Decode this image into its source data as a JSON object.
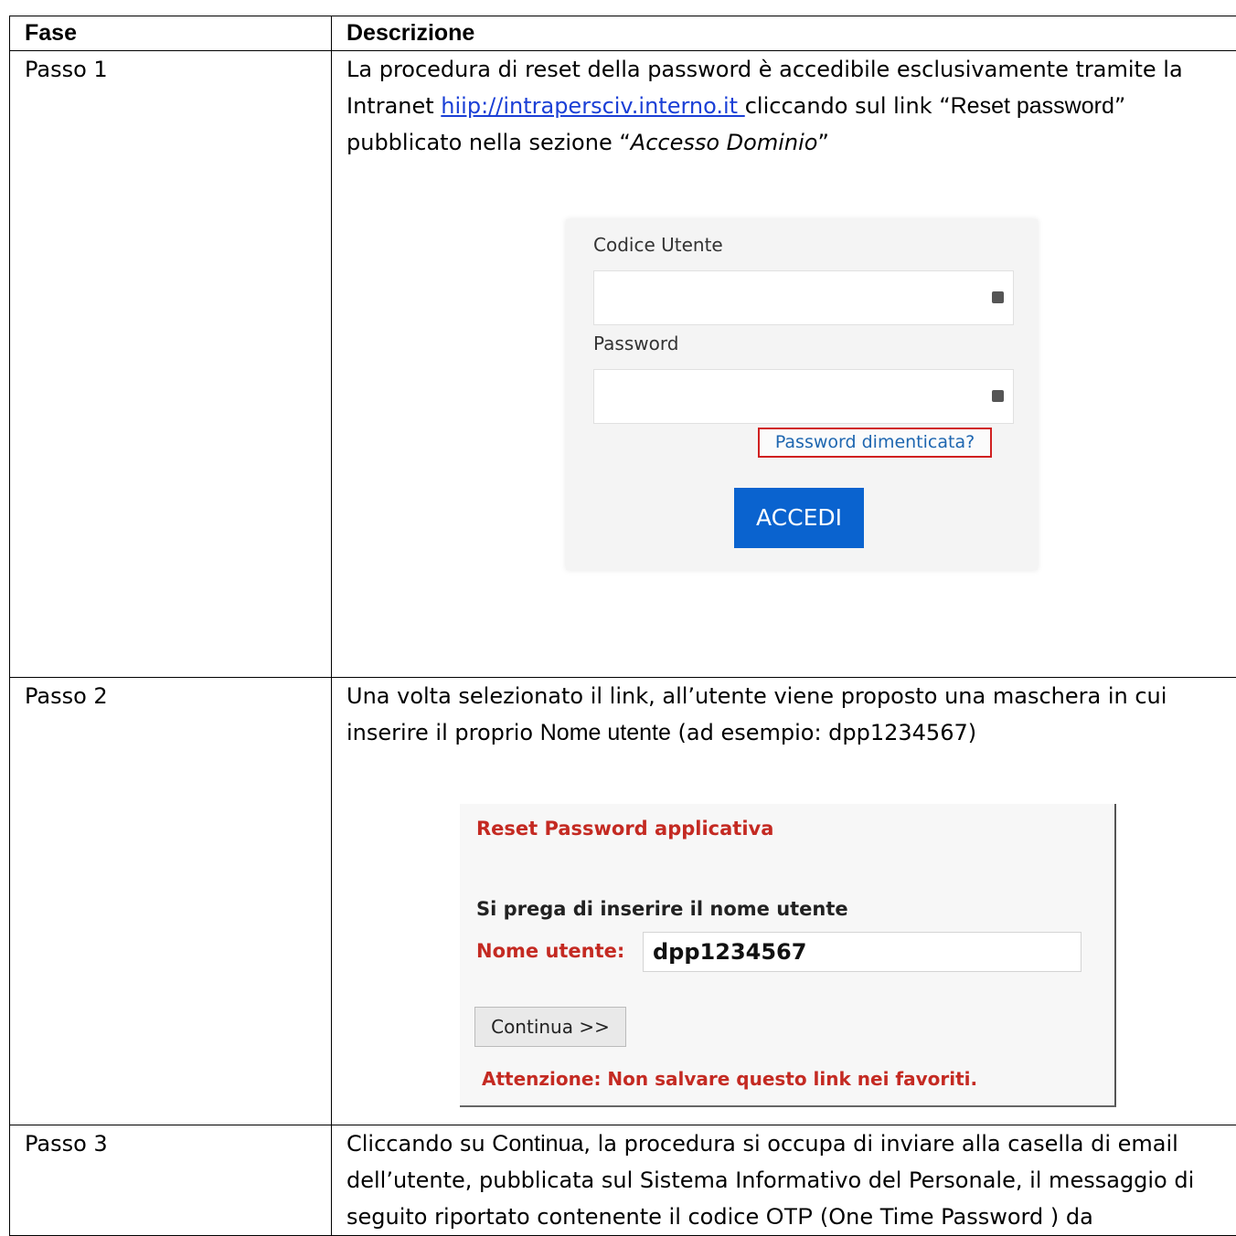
{
  "table": {
    "headers": {
      "phase": "Fase",
      "description": "Descrizione"
    },
    "rows": [
      {
        "step": "Passo 1",
        "t1": "La procedura di reset della password è accedibile esclusivamente tramite la Intranet ",
        "link": "hiip://intrapersciv.interno.it ",
        "t2": " cliccando sul link “",
        "b1": "Reset password",
        "t3": "” pubblicato nella sezione “",
        "i1": "Accesso Dominio",
        "t4": "”"
      },
      {
        "step": "Passo 2",
        "t1": "Una volta selezionato il link, all’utente viene proposto una maschera in cui inserire il proprio ",
        "b1": "Nome utente",
        "t2": " (ad esempio: dpp1234567)"
      },
      {
        "step": "Passo 3",
        "t1": "Cliccando su ",
        "b1": "Continua",
        "t2": ", la procedura si occupa di inviare alla casella di email dell’utente, pubblicata sul Sistema Informativo del Personale, il messaggio di seguito riportato contenente il codice ",
        "b2": "OTP",
        "t3": " (One Time Password ) da"
      }
    ]
  },
  "login_screen": {
    "user_label": "Codice Utente",
    "password_label": "Password",
    "forgot_link": "Password dimenticata?",
    "accedi_button": "ACCEDI",
    "accent_color": "#0a63cf",
    "highlight_color": "#d02020"
  },
  "reset_screen": {
    "title": "Reset Password applicativa",
    "prompt": "Si prega di inserire il nome utente",
    "name_label": "Nome utente:",
    "name_value": "dpp1234567",
    "continue_button": "Continua >>",
    "warning": "Attenzione: Non salvare questo link nei favoriti.",
    "accent_color": "#c42a22"
  }
}
